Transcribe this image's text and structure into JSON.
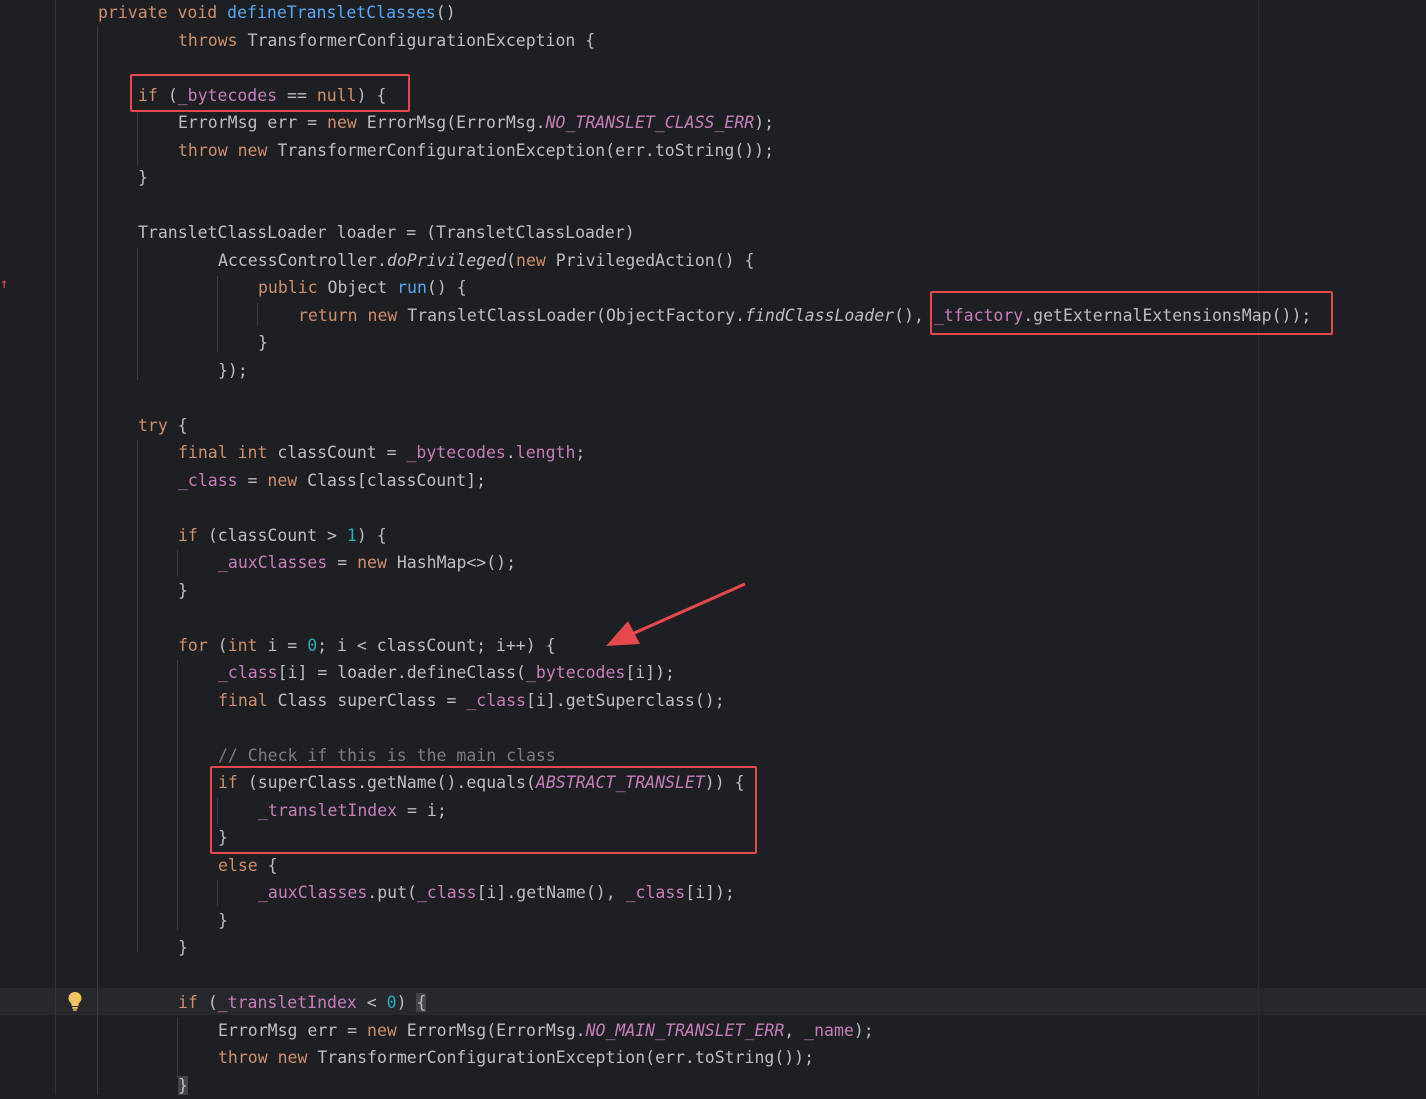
{
  "editor": {
    "lines": [
      [
        [
          "kw",
          "private "
        ],
        [
          "kw",
          "void "
        ],
        [
          "fn",
          "defineTransletClasses"
        ],
        [
          "",
          "()"
        ]
      ],
      [
        [
          "kw",
          "throws "
        ],
        [
          "",
          "TransformerConfigurationException {"
        ]
      ],
      [],
      [
        [
          "kw",
          "if "
        ],
        [
          "",
          "("
        ],
        [
          "fld",
          "_bytecodes"
        ],
        [
          "",
          " == "
        ],
        [
          "kw",
          "null"
        ],
        [
          "",
          ") {"
        ]
      ],
      [
        [
          "",
          "ErrorMsg err = "
        ],
        [
          "kw",
          "new "
        ],
        [
          "",
          "ErrorMsg(ErrorMsg."
        ],
        [
          "fldi",
          "NO_TRANSLET_CLASS_ERR"
        ],
        [
          "",
          ");"
        ]
      ],
      [
        [
          "kw",
          "throw "
        ],
        [
          "kw",
          "new "
        ],
        [
          "",
          "TransformerConfigurationException(err.toString());"
        ]
      ],
      [
        [
          "",
          "}"
        ]
      ],
      [],
      [
        [
          "",
          "TransletClassLoader loader = (TransletClassLoader)"
        ]
      ],
      [
        [
          "",
          "AccessController."
        ],
        [
          "sti",
          "doPrivileged"
        ],
        [
          "",
          "("
        ],
        [
          "kw",
          "new "
        ],
        [
          "",
          "PrivilegedAction() {"
        ]
      ],
      [
        [
          "kw",
          "public "
        ],
        [
          "",
          "Object "
        ],
        [
          "fn",
          "run"
        ],
        [
          "",
          "() {"
        ]
      ],
      [
        [
          "kw",
          "return "
        ],
        [
          "kw",
          "new "
        ],
        [
          "",
          "TransletClassLoader(ObjectFactory."
        ],
        [
          "sti",
          "findClassLoader"
        ],
        [
          "",
          "(), "
        ],
        [
          "fld",
          "_tfactory"
        ],
        [
          "",
          ".getExternalExtensionsMap());"
        ]
      ],
      [
        [
          "",
          "}"
        ]
      ],
      [
        [
          "",
          "});"
        ]
      ],
      [],
      [
        [
          "kw",
          "try "
        ],
        [
          "",
          "{"
        ]
      ],
      [
        [
          "kw",
          "final "
        ],
        [
          "kw",
          "int "
        ],
        [
          "",
          "classCount = "
        ],
        [
          "fld",
          "_bytecodes"
        ],
        [
          "",
          "."
        ],
        [
          "fld",
          "length"
        ],
        [
          "",
          ";"
        ]
      ],
      [
        [
          "fld",
          "_class"
        ],
        [
          "",
          " = "
        ],
        [
          "kw",
          "new "
        ],
        [
          "",
          "Class[classCount];"
        ]
      ],
      [],
      [
        [
          "kw",
          "if "
        ],
        [
          "",
          "(classCount > "
        ],
        [
          "num",
          "1"
        ],
        [
          "",
          ") {"
        ]
      ],
      [
        [
          "fld",
          "_auxClasses"
        ],
        [
          "",
          " = "
        ],
        [
          "kw",
          "new "
        ],
        [
          "",
          "HashMap<>();"
        ]
      ],
      [
        [
          "",
          "}"
        ]
      ],
      [],
      [
        [
          "kw",
          "for "
        ],
        [
          "",
          "("
        ],
        [
          "kw",
          "int "
        ],
        [
          "",
          "i = "
        ],
        [
          "num",
          "0"
        ],
        [
          "",
          "; i < classCount; i++) {"
        ]
      ],
      [
        [
          "fld",
          "_class"
        ],
        [
          "",
          "[i] = loader.defineClass("
        ],
        [
          "fld",
          "_bytecodes"
        ],
        [
          "",
          "[i]);"
        ]
      ],
      [
        [
          "kw",
          "final "
        ],
        [
          "",
          "Class superClass = "
        ],
        [
          "fld",
          "_class"
        ],
        [
          "",
          "[i].getSuperclass();"
        ]
      ],
      [],
      [
        [
          "cmt",
          "// Check if this is the main class"
        ]
      ],
      [
        [
          "kw",
          "if "
        ],
        [
          "",
          "(superClass.getName().equals("
        ],
        [
          "fldi",
          "ABSTRACT_TRANSLET"
        ],
        [
          "",
          ")) {"
        ]
      ],
      [
        [
          "fld",
          "_transletIndex"
        ],
        [
          "",
          " = i;"
        ]
      ],
      [
        [
          "",
          "}"
        ]
      ],
      [
        [
          "kw",
          "else "
        ],
        [
          "",
          "{"
        ]
      ],
      [
        [
          "fld",
          "_auxClasses"
        ],
        [
          "",
          ".put("
        ],
        [
          "fld",
          "_class"
        ],
        [
          "",
          "[i].getName(), "
        ],
        [
          "fld",
          "_class"
        ],
        [
          "",
          "[i]);"
        ]
      ],
      [
        [
          "",
          "}"
        ]
      ],
      [
        [
          "",
          "}"
        ]
      ],
      [],
      [
        [
          "kw",
          "if "
        ],
        [
          "",
          "("
        ],
        [
          "fld",
          "_transletIndex"
        ],
        [
          "",
          " < "
        ],
        [
          "num",
          "0"
        ],
        [
          "",
          ") "
        ],
        [
          "brace",
          "{"
        ]
      ],
      [
        [
          "",
          "ErrorMsg err = "
        ],
        [
          "kw",
          "new "
        ],
        [
          "",
          "ErrorMsg(ErrorMsg."
        ],
        [
          "fldi",
          "NO_MAIN_TRANSLET_ERR"
        ],
        [
          "",
          ", "
        ],
        [
          "fld",
          "_name"
        ],
        [
          "",
          ");"
        ]
      ],
      [
        [
          "kw",
          "throw "
        ],
        [
          "kw",
          "new "
        ],
        [
          "",
          "TransformerConfigurationException(err.toString());"
        ]
      ],
      [
        [
          "brace",
          "}"
        ]
      ]
    ]
  },
  "annotations": {
    "arrow_color": "#e5484d",
    "box_color": "#e5484d",
    "highlighted": [
      "if (_bytecodes == null) {",
      "_tfactory.getExternalExtensionsMap());",
      "if (superClass.getName().equals(ABSTRACT_TRANSLET)) {"
    ]
  },
  "gutter": {
    "icons": [
      "lightbulb-icon",
      "override-marker-icon"
    ]
  }
}
